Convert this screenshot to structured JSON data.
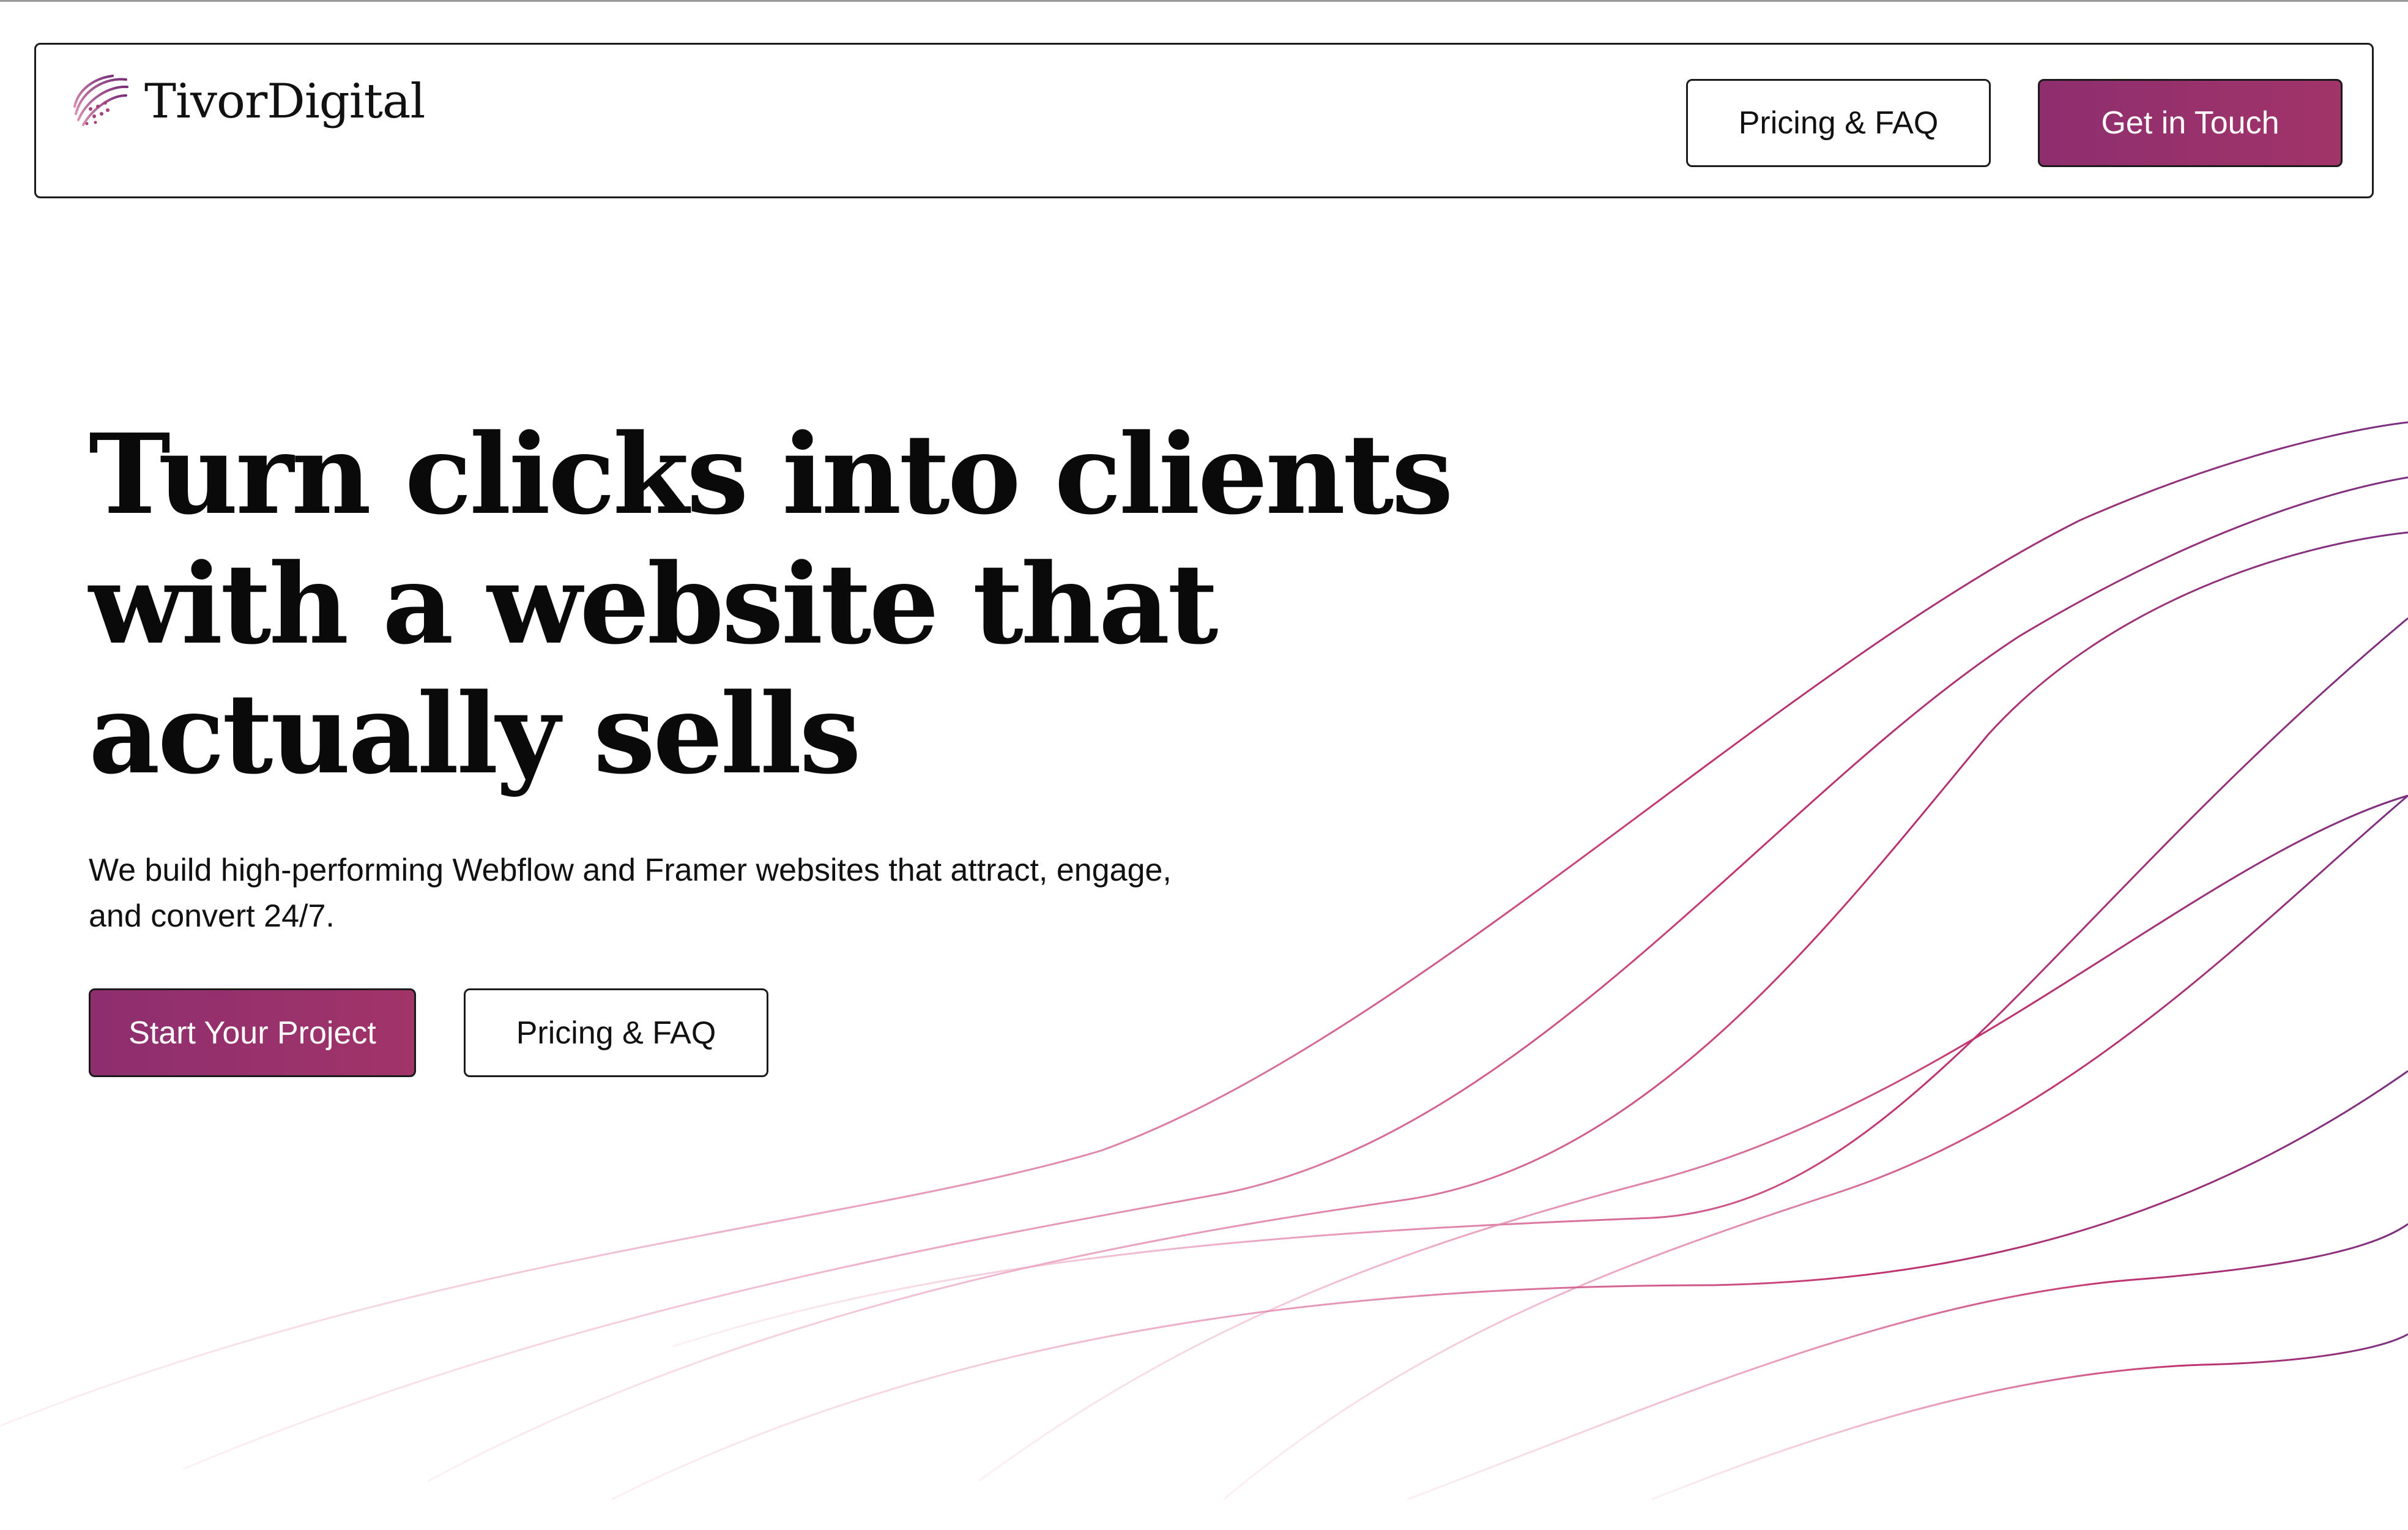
{
  "brand": {
    "name": "TivorDigital",
    "logo_icon": "swirl-sphere-logo-icon"
  },
  "nav": {
    "pricing_label": "Pricing & FAQ",
    "contact_label": "Get in Touch"
  },
  "hero": {
    "title_lines": [
      "Turn clicks into clients",
      "with a website that",
      "actually sells"
    ],
    "subtitle_lines": [
      "We build high-performing Webflow and Framer websites that attract, engage,",
      "and convert 24/7."
    ],
    "primary_cta": "Start Your Project",
    "secondary_cta": "Pricing & FAQ"
  },
  "colors": {
    "accent": "#9b2f6b",
    "accent_end": "#a13469",
    "wave_start": "#e8a0bf",
    "wave_end": "#7a2e7a",
    "text": "#0b0b0b",
    "border": "#1a1a1a"
  }
}
